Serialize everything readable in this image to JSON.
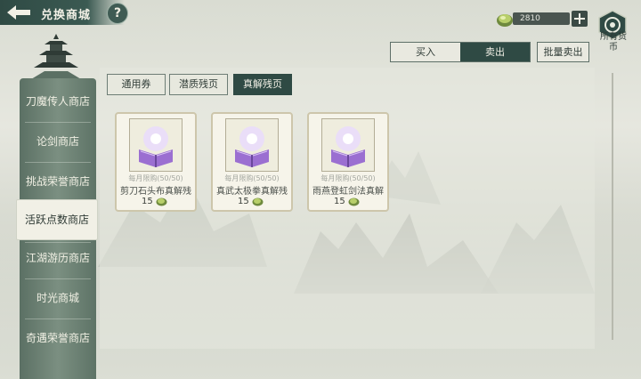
{
  "header": {
    "title": "兑换商城",
    "help": "?"
  },
  "currency": {
    "amount": "2810",
    "plus": "+"
  },
  "all_currency": {
    "label": "所有货币"
  },
  "trade_tabs": {
    "buy": "买入",
    "sell": "卖出",
    "active": "sell"
  },
  "bulk_sell": "批量卖出",
  "sidebar": {
    "items": [
      {
        "label": "刀魔传人商店",
        "active": false
      },
      {
        "label": "论剑商店",
        "active": false
      },
      {
        "label": "挑战荣誉商店",
        "active": false
      },
      {
        "label": "活跃点数商店",
        "active": true
      },
      {
        "label": "江湖游历商店",
        "active": false
      },
      {
        "label": "时光商城",
        "active": false
      },
      {
        "label": "奇遇荣誉商店",
        "active": false
      }
    ]
  },
  "category_tabs": [
    {
      "label": "通用券",
      "active": false
    },
    {
      "label": "潜质残页",
      "active": false
    },
    {
      "label": "真解残页",
      "active": true
    }
  ],
  "items": [
    {
      "limit": "每月限购(50/50)",
      "name": "剪刀石头布真解残",
      "price": "15",
      "icon": "purple-book-icon"
    },
    {
      "limit": "每月限购(50/50)",
      "name": "真武太极拳真解残",
      "price": "15",
      "icon": "purple-book-icon"
    },
    {
      "limit": "每月限购(50/50)",
      "name": "雨燕登虹剑法真解",
      "price": "15",
      "icon": "purple-book-icon"
    }
  ],
  "colors": {
    "accent_dark": "#2f4a44",
    "panel": "#e7e8de",
    "card_border": "#cdc6ab",
    "book_purple": "#9b6fd1"
  }
}
